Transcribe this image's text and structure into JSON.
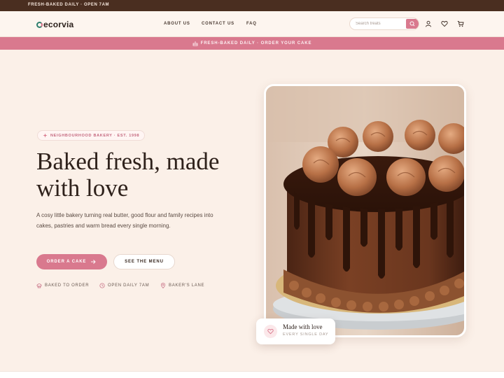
{
  "topbar": {
    "text": "FRESH-BAKED DAILY · OPEN 7AM"
  },
  "header": {
    "logo": "ecorvia",
    "nav": [
      "ABOUT US",
      "CONTACT US",
      "FAQ"
    ],
    "search_placeholder": "Search treats",
    "icons": [
      "search-icon",
      "user-icon",
      "heart-icon",
      "cart-icon"
    ]
  },
  "promo": {
    "text": "FRESH-BAKED DAILY · ORDER YOUR CAKE",
    "icon": "cake-icon"
  },
  "hero": {
    "badge": "NEIGHBOURHOOD BAKERY · EST. 1998",
    "title_line1": "Baked fresh, made",
    "title_line2": "with love",
    "lead": "A cosy little bakery turning real butter, good flour and family recipes into cakes, pastries and warm bread every single morning.",
    "primary_button": "ORDER A CAKE",
    "secondary_button": "SEE THE MENU",
    "features": [
      "BAKED TO ORDER",
      "OPEN DAILY 7AM",
      "BAKER'S LANE"
    ]
  },
  "card": {
    "title": "Made with love",
    "subtitle": "EVERY SINGLE DAY"
  },
  "colors": {
    "accent": "#d9798e",
    "dark": "#4a2e20",
    "background": "#fbf0e8"
  }
}
